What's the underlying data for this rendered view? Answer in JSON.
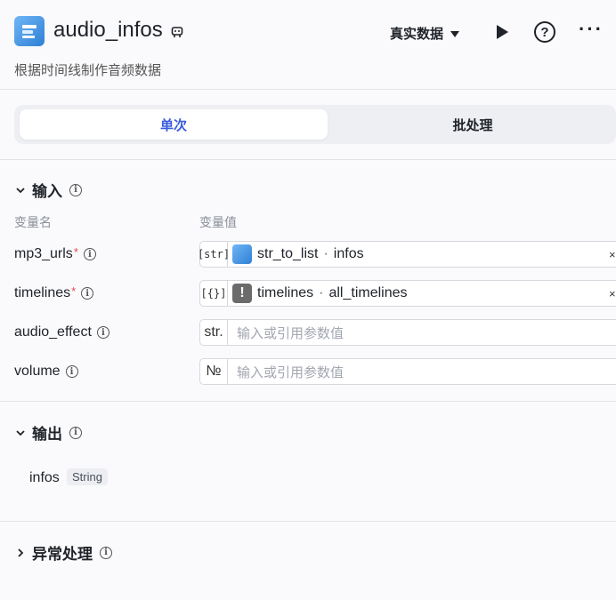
{
  "header": {
    "title": "audio_infos",
    "subtitle": "根据时间线制作音频数据",
    "mode_label": "真实数据"
  },
  "tabs": [
    {
      "label": "单次",
      "active": true
    },
    {
      "label": "批处理",
      "active": false
    }
  ],
  "input_section": {
    "title": "输入",
    "col_name": "变量名",
    "col_value": "变量值",
    "params": [
      {
        "name": "mp3_urls",
        "required": true,
        "type_badge": "[str]",
        "ref_node": "str_to_list",
        "ref_field": "infos",
        "icon": "node-icon"
      },
      {
        "name": "timelines",
        "required": true,
        "type_badge": "[{}]",
        "ref_node": "timelines",
        "ref_field": "all_timelines",
        "icon": "warning-icon"
      },
      {
        "name": "audio_effect",
        "required": false,
        "type_badge": "str.",
        "placeholder": "输入或引用参数值"
      },
      {
        "name": "volume",
        "required": false,
        "type_badge": "№",
        "placeholder": "输入或引用参数值"
      }
    ]
  },
  "output_section": {
    "title": "输出",
    "outputs": [
      {
        "name": "infos",
        "type": "String"
      }
    ]
  },
  "exception_section": {
    "title": "异常处理"
  },
  "colors": {
    "accent": "#3b5bdb",
    "required": "#e5484d",
    "background": "#fafafc"
  }
}
